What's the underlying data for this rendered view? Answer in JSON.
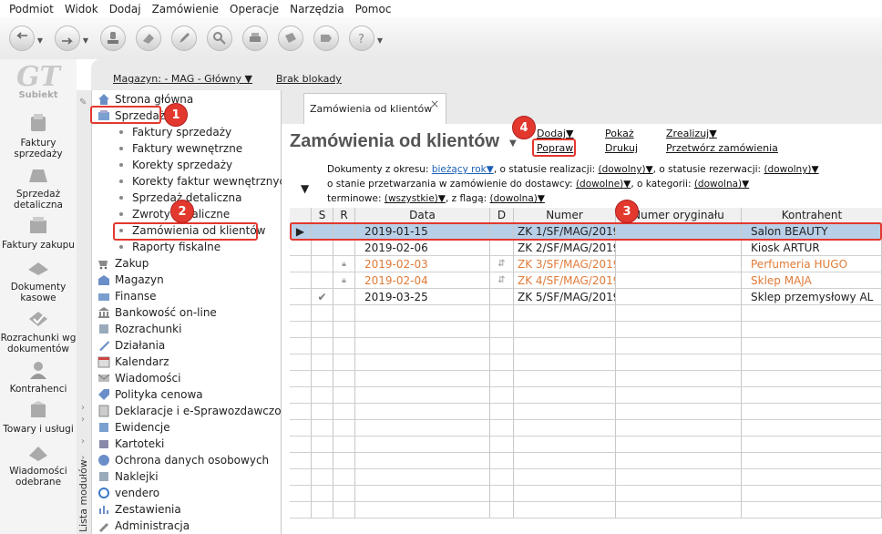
{
  "menu": [
    "Podmiot",
    "Widok",
    "Dodaj",
    "Zamówienie",
    "Operacje",
    "Narzędzia",
    "Pomoc"
  ],
  "logo": {
    "mark": "GT",
    "text": "Subiekt"
  },
  "modules": [
    {
      "label": "Faktury sprzedaży",
      "icon": "invoices-icon"
    },
    {
      "label": "Sprzedaż detaliczna",
      "icon": "retail-icon"
    },
    {
      "label": "Faktury zakupu",
      "icon": "purchase-invoices-icon"
    },
    {
      "label": "Dokumenty kasowe",
      "icon": "cash-documents-icon"
    },
    {
      "label": "Rozrachunki wg dokumentów",
      "icon": "settlements-icon"
    },
    {
      "label": "Kontrahenci",
      "icon": "contractors-icon"
    },
    {
      "label": "Towary i usługi",
      "icon": "goods-icon"
    },
    {
      "label": "Wiadomości odebrane",
      "icon": "messages-icon"
    }
  ],
  "topline": {
    "magazyn": "Magazyn: - MAG - Główny",
    "blokada": "Brak blokady"
  },
  "tree_side_label": "Lista modułów",
  "tree": {
    "items": [
      {
        "label": "Strona główna",
        "icon": "home-icon"
      },
      {
        "label": "Sprzedaż",
        "icon": "sales-icon"
      },
      {
        "label": "Zakup",
        "icon": "purchase-icon"
      },
      {
        "label": "Magazyn",
        "icon": "warehouse-icon"
      },
      {
        "label": "Finanse",
        "icon": "finance-icon"
      },
      {
        "label": "Bankowość on-line",
        "icon": "banking-icon"
      },
      {
        "label": "Rozrachunki",
        "icon": "settlements-tree-icon"
      },
      {
        "label": "Działania",
        "icon": "actions-icon"
      },
      {
        "label": "Kalendarz",
        "icon": "calendar-icon"
      },
      {
        "label": "Wiadomości",
        "icon": "messages-tree-icon"
      },
      {
        "label": "Polityka cenowa",
        "icon": "pricing-icon"
      },
      {
        "label": "Deklaracje i e-Sprawozdawczość",
        "icon": "declarations-icon"
      },
      {
        "label": "Ewidencje",
        "icon": "records-icon"
      },
      {
        "label": "Kartoteki",
        "icon": "files-icon"
      },
      {
        "label": "Ochrona danych osobowych",
        "icon": "privacy-icon"
      },
      {
        "label": "Naklejki",
        "icon": "stickers-icon"
      },
      {
        "label": "vendero",
        "icon": "vendero-icon"
      },
      {
        "label": "Zestawienia",
        "icon": "reports-icon"
      },
      {
        "label": "Administracja",
        "icon": "admin-icon"
      }
    ],
    "sub": [
      "Faktury sprzedaży",
      "Faktury wewnętrzne",
      "Korekty sprzedaży",
      "Korekty faktur wewnętrznych",
      "Sprzedaż detaliczna",
      "Zwroty detaliczne",
      "Zamówienia od klientów",
      "Raporty fiskalne"
    ]
  },
  "tab": {
    "label": "Zamówienia od klientów",
    "close": "×"
  },
  "page_title": "Zamówienia od klientów",
  "actions": {
    "dodaj": "Dodaj",
    "popraw": "Popraw",
    "pokaz": "Pokaż",
    "drukuj": "Drukuj",
    "zrealizuj": "Zrealizuj",
    "przetworz": "Przetwórz zamówienia"
  },
  "filters": {
    "okres_label": "Dokumenty z okresu:",
    "okres_val": "bieżący rok",
    "realizacji_label": ", o statusie realizacji:",
    "realizacji_val": "(dowolny)",
    "rezerwacji_label": ", o statusie rezerwacji:",
    "rezerwacji_val": "(dowolny)",
    "przetwarzania_label": "o stanie przetwarzania w zamówienie do dostawcy:",
    "przetwarzania_val": "(dowolne)",
    "kategorii_label": ", o kategorii:",
    "kategorii_val": "(dowolna)",
    "terminowe_label": "terminowe:",
    "terminowe_val": "(wszystkie)",
    "flaga_label": ", z flagą:",
    "flaga_val": "(dowolna)"
  },
  "grid": {
    "columns": [
      "S",
      "R",
      "Data",
      "D",
      "Numer",
      "Numer oryginału",
      "Kontrahent"
    ],
    "rows": [
      {
        "s": "",
        "r": "",
        "data": "2019-01-15",
        "d": "",
        "numer": "ZK 1/SF/MAG/2019",
        "orig": "",
        "kontrahent": "Salon BEAUTY",
        "status": "selected"
      },
      {
        "s": "",
        "r": "",
        "data": "2019-02-06",
        "d": "",
        "numer": "ZK 2/SF/MAG/2019",
        "orig": "",
        "kontrahent": "Kiosk ARTUR",
        "status": "normal"
      },
      {
        "s": "",
        "r": "lock",
        "data": "2019-02-03",
        "d": "doc",
        "numer": "ZK 3/SF/MAG/2019",
        "orig": "",
        "kontrahent": "Perfumeria HUGO",
        "status": "orange"
      },
      {
        "s": "",
        "r": "lock",
        "data": "2019-02-04",
        "d": "doc",
        "numer": "ZK 4/SF/MAG/2019",
        "orig": "",
        "kontrahent": "Sklep MAJA",
        "status": "orange"
      },
      {
        "s": "check",
        "r": "",
        "data": "2019-03-25",
        "d": "",
        "numer": "ZK 5/SF/MAG/2019",
        "orig": "",
        "kontrahent": "Sklep przemysłowy AL",
        "status": "normal"
      }
    ]
  },
  "callouts": [
    "1",
    "2",
    "3",
    "4"
  ],
  "colors": {
    "accent": "#e3382e",
    "selected_row": "#b8cfe8",
    "orange_text": "#e07b39",
    "link_blue": "#1a5fb4"
  }
}
